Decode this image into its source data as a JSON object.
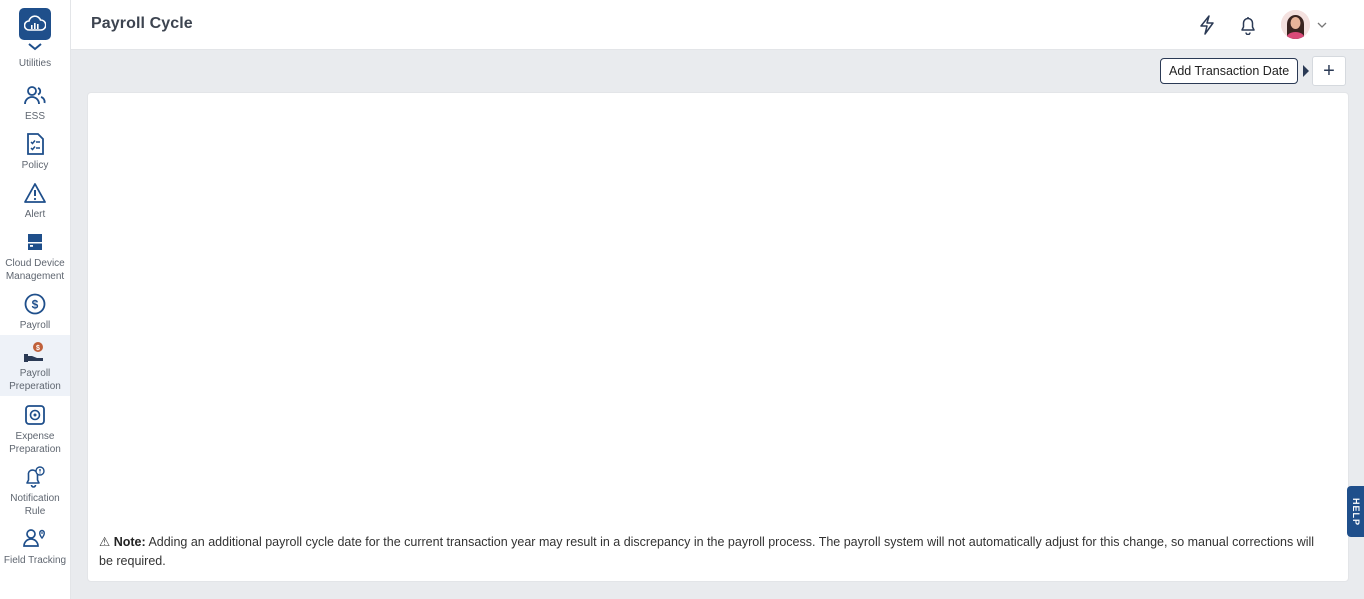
{
  "header": {
    "title": "Payroll Cycle"
  },
  "sidebar": {
    "items": [
      {
        "label": "Utilities",
        "icon": "utilities-icon"
      },
      {
        "label": "ESS",
        "icon": "people-icon"
      },
      {
        "label": "Policy",
        "icon": "policy-checklist-icon"
      },
      {
        "label": "Alert",
        "icon": "warning-triangle-icon"
      },
      {
        "label": "Cloud Device Management",
        "icon": "device-icon"
      },
      {
        "label": "Payroll",
        "icon": "dollar-circle-icon"
      },
      {
        "label": "Payroll Preperation",
        "icon": "hand-coin-icon"
      },
      {
        "label": "Expense Preparation",
        "icon": "expense-icon"
      },
      {
        "label": "Notification Rule",
        "icon": "bell-alert-icon"
      },
      {
        "label": "Field Tracking",
        "icon": "person-location-icon"
      }
    ]
  },
  "toolbar": {
    "add_label": "+",
    "tooltip": "Add Transaction Date"
  },
  "note": {
    "icon": "⚠",
    "label": "Note:",
    "text": " Adding an additional payroll cycle date for the current transaction year may result in a discrepancy in the payroll process. The payroll system will not automatically adjust for this change, so manual corrections will be required."
  },
  "help": {
    "label": "HELP"
  },
  "colors": {
    "brand": "#1f4f8b",
    "background": "#e9ebee"
  }
}
